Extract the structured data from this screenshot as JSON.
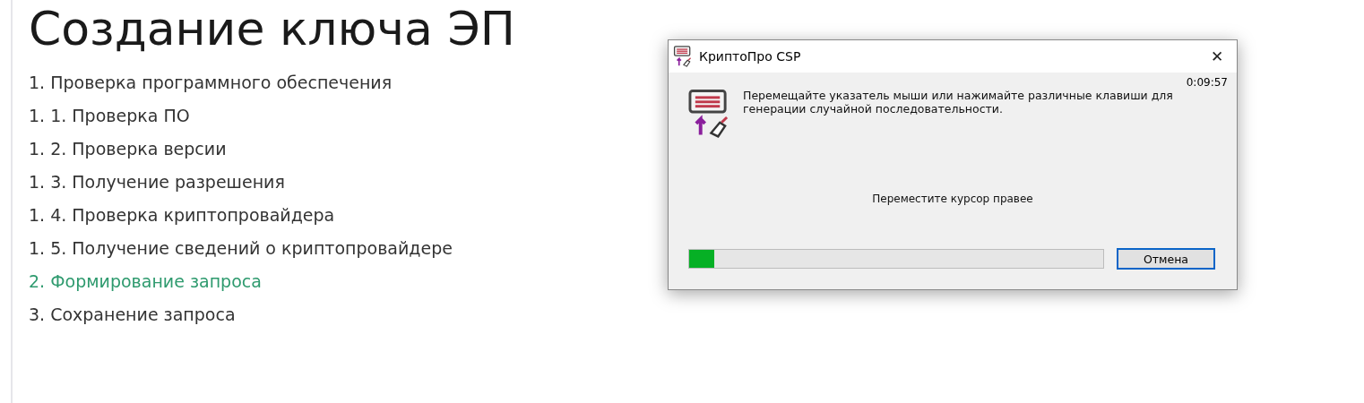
{
  "page": {
    "title": "Создание ключа ЭП"
  },
  "steps": [
    {
      "label": "1. Проверка программного обеспечения",
      "selected": false
    },
    {
      "label": "1. 1. Проверка ПО",
      "selected": false
    },
    {
      "label": "1. 2. Проверка версии",
      "selected": false
    },
    {
      "label": "1. 3. Получение разрешения",
      "selected": false
    },
    {
      "label": "1. 4. Проверка криптопровайдера",
      "selected": false
    },
    {
      "label": "1. 5. Получение сведений о криптопровайдере",
      "selected": false
    },
    {
      "label": "2. Формирование запроса",
      "selected": true
    },
    {
      "label": "3. Сохранение запроса",
      "selected": false
    }
  ],
  "dialog": {
    "title": "КриптоПро CSP",
    "close": "✕",
    "timer": "0:09:57",
    "message": "Перемещайте указатель мыши или нажимайте различные клавиши для генерации случайной последовательности.",
    "hint": "Переместите курсор правее",
    "progress": {
      "level": 0.06
    },
    "buttons": [
      "Отмена"
    ]
  }
}
